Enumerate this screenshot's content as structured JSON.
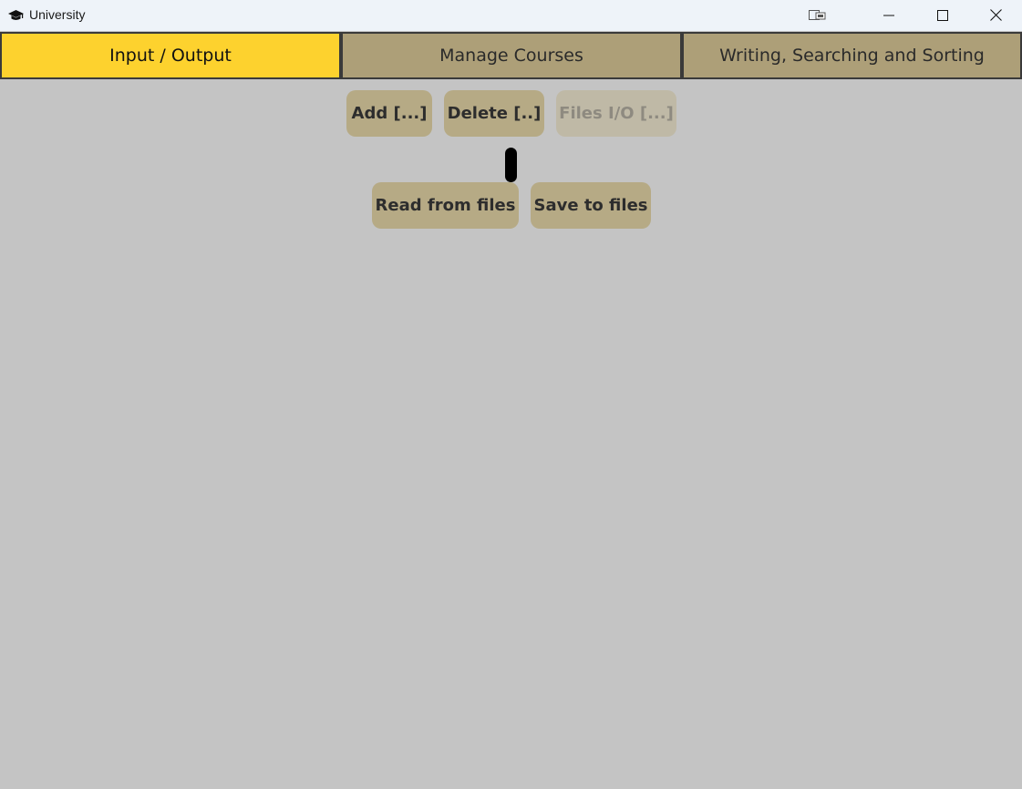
{
  "window": {
    "title": "University",
    "app_icon": "graduation-cap-icon"
  },
  "titlebar_buttons": {
    "snap_icon": "snap-layout-icon",
    "minimize_icon": "minimize-icon",
    "maximize_icon": "maximize-icon",
    "close_icon": "close-icon"
  },
  "tabs": [
    {
      "label": "Input / Output",
      "active": true
    },
    {
      "label": "Manage Courses",
      "active": false
    },
    {
      "label": "Writing, Searching and Sorting",
      "active": false
    }
  ],
  "menu_buttons": {
    "add": "Add [...]",
    "delete": "Delete [..]",
    "files_io": "Files I/O [...]"
  },
  "file_actions": {
    "read": "Read from files",
    "save": "Save to files"
  },
  "colors": {
    "background": "#c4c4c4",
    "tab_active": "#fdd22e",
    "tab_inactive": "#ad9f78",
    "button": "#b6aa85",
    "button_disabled": "#bfb9a6"
  }
}
